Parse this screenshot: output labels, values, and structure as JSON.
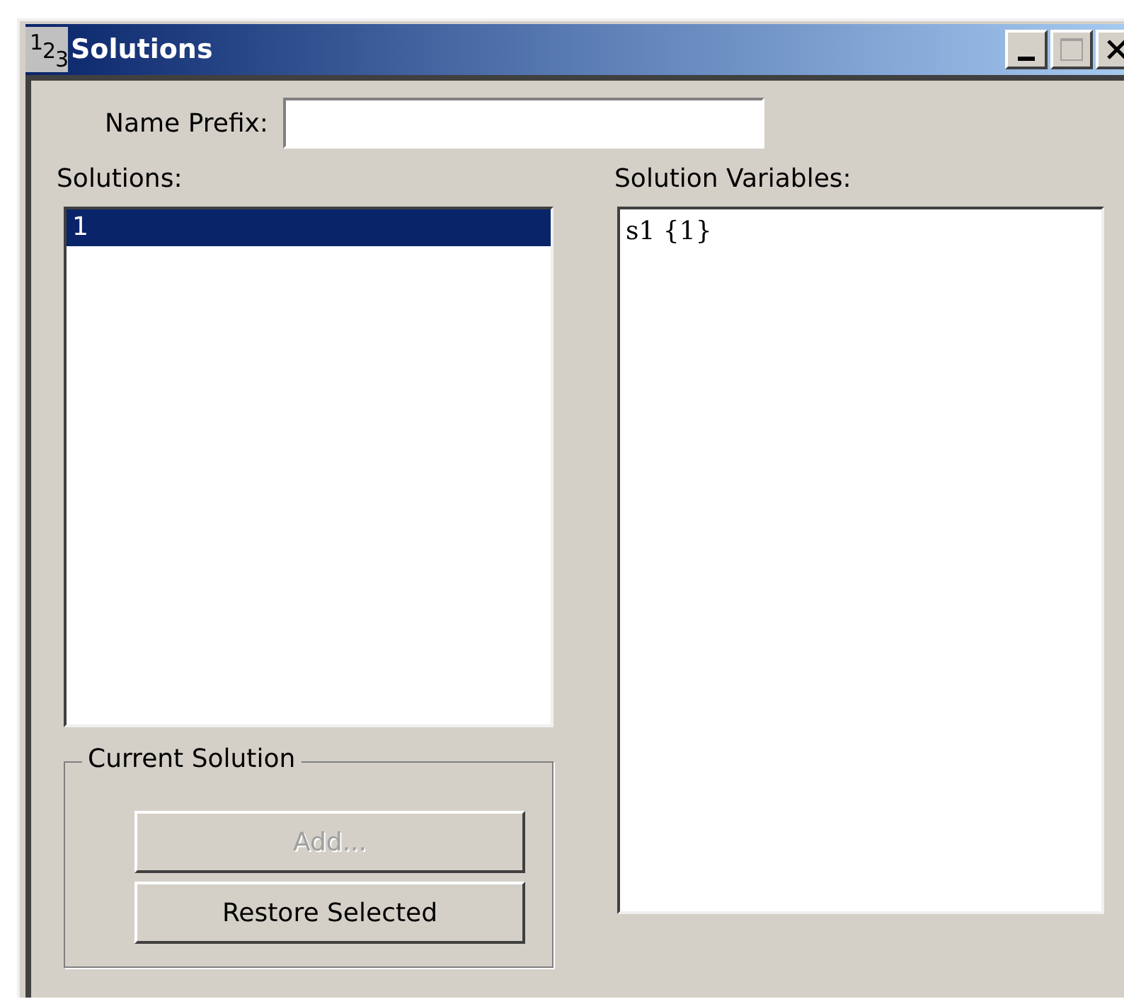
{
  "window": {
    "icon": [
      "1",
      "2",
      "3"
    ],
    "title": "Solutions"
  },
  "name_prefix": {
    "label": "Name Prefix:"
  },
  "solutions": {
    "label": "Solutions:",
    "items": [
      {
        "text": "1",
        "selected": true
      }
    ]
  },
  "solution_variables": {
    "label": "Solution Variables:",
    "items": [
      "s1 {1}"
    ]
  },
  "current_solution": {
    "title": "Current Solution",
    "buttons": [
      {
        "label": "Add...",
        "disabled": true
      },
      {
        "label": "Restore Selected",
        "disabled": false
      }
    ]
  }
}
